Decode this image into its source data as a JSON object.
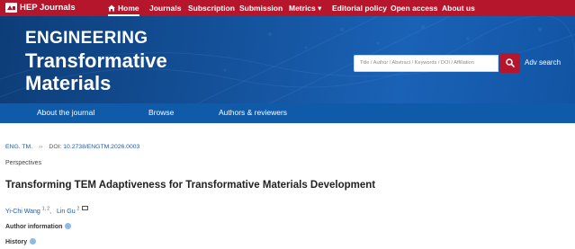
{
  "topnav": {
    "logo_text": "HEP Journals",
    "items": [
      {
        "label": "Home",
        "active": true
      },
      {
        "label": "Journals"
      },
      {
        "label": "Subscription"
      },
      {
        "label": "Submission"
      },
      {
        "label": "Metrics ▾"
      },
      {
        "label": "Editorial policy"
      },
      {
        "label": "Open access"
      },
      {
        "label": "About us"
      }
    ]
  },
  "banner": {
    "title_line1": "ENGINEERING",
    "title_line2": "Transformative",
    "title_line3": "Materials",
    "search_placeholder": "Title / Author / Abstract / Keywords / DOI / Affiliation",
    "adv_search_label": "Adv search"
  },
  "subnav": {
    "items": [
      "About the journal",
      "Browse",
      "Authors & reviewers"
    ]
  },
  "article": {
    "journal_abbrev": "ENG. TM.",
    "crumb_sep": "››",
    "doi_label": "DOI:",
    "doi_value": "10.2738/ENGTM.2026.0003",
    "section": "Perspectives",
    "title": "Transforming TEM Adaptiveness for Transformative Materials Development",
    "authors": [
      {
        "name": "Yi-Chi Wang",
        "affil": "1, 2"
      },
      {
        "name": "Lin Gu",
        "affil": "2"
      }
    ],
    "author_info_label": "Author information",
    "history_label": "History"
  },
  "colors": {
    "brand_red": "#b5162b",
    "banner_blue": "#1a5fae",
    "subnav_blue": "#0f5aa9",
    "link_blue": "#1f5aa6"
  }
}
